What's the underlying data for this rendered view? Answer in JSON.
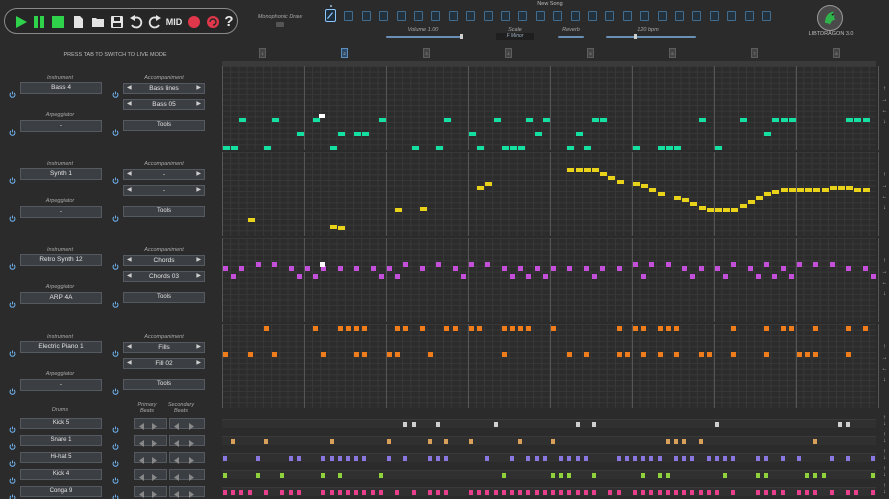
{
  "toolbar": {
    "mid_label": "MID",
    "help_label": "?",
    "monophonic_label": "Monophonic Draw",
    "song_title": "New Song",
    "volume_label": "Volume 1.00",
    "scale_label": "Scale",
    "scale_value": "F Minor",
    "reverb_label": "Reverb",
    "bpm_label": "120 bpm",
    "brand": "LIBTDRAGON 3.0",
    "tab_hint": "PRESS TAB TO SWITCH TO LIVE MODE",
    "pattern_count": 26
  },
  "colors": {
    "bass": "#14e0a2",
    "synth": "#e8d31a",
    "retro": "#c44fd8",
    "piano": "#ef7d1c",
    "kick5": "#cfcfcf",
    "snare": "#d9a05a",
    "hihat": "#8a78e0",
    "kick4": "#8fd23b",
    "conga": "#e83f8c",
    "accent": "#8ac6ff"
  },
  "tracks": [
    {
      "instrument_label": "Instrument",
      "instrument": "Bass 4",
      "accompaniment_label": "Accompaniment",
      "acc_style": "Bass lines",
      "acc_pattern": "Bass 05",
      "arp_label": "Arpeggiator",
      "arp": "-",
      "tools": "Tools"
    },
    {
      "instrument_label": "Instrument",
      "instrument": "Synth 1",
      "accompaniment_label": "Accompaniment",
      "acc_style": "-",
      "acc_pattern": "-",
      "arp_label": "Arpeggiator",
      "arp": "-",
      "tools": "Tools"
    },
    {
      "instrument_label": "Instrument",
      "instrument": "Retro Synth 12",
      "accompaniment_label": "Accompaniment",
      "acc_style": "Chords",
      "acc_pattern": "Chords 03",
      "arp_label": "Arpeggiator",
      "arp": "ARP 4A",
      "tools": "Tools"
    },
    {
      "instrument_label": "Instrument",
      "instrument": "Electric Piano 1",
      "accompaniment_label": "Accompaniment",
      "acc_style": "Fills",
      "acc_pattern": "Fill 02",
      "arp_label": "Arpeggiator",
      "arp": "-",
      "tools": "Tools"
    }
  ],
  "drums": {
    "label": "Drums",
    "primary_label": "Primary Beats",
    "secondary_label": "Secondary Beats",
    "kits": [
      "Kick 5",
      "Snare 1",
      "Hi-hat 5",
      "Kick 4",
      "Conga 9"
    ]
  },
  "section_markers": [
    "1",
    "2",
    "3",
    "4",
    "5",
    "6",
    "7",
    "8"
  ]
}
